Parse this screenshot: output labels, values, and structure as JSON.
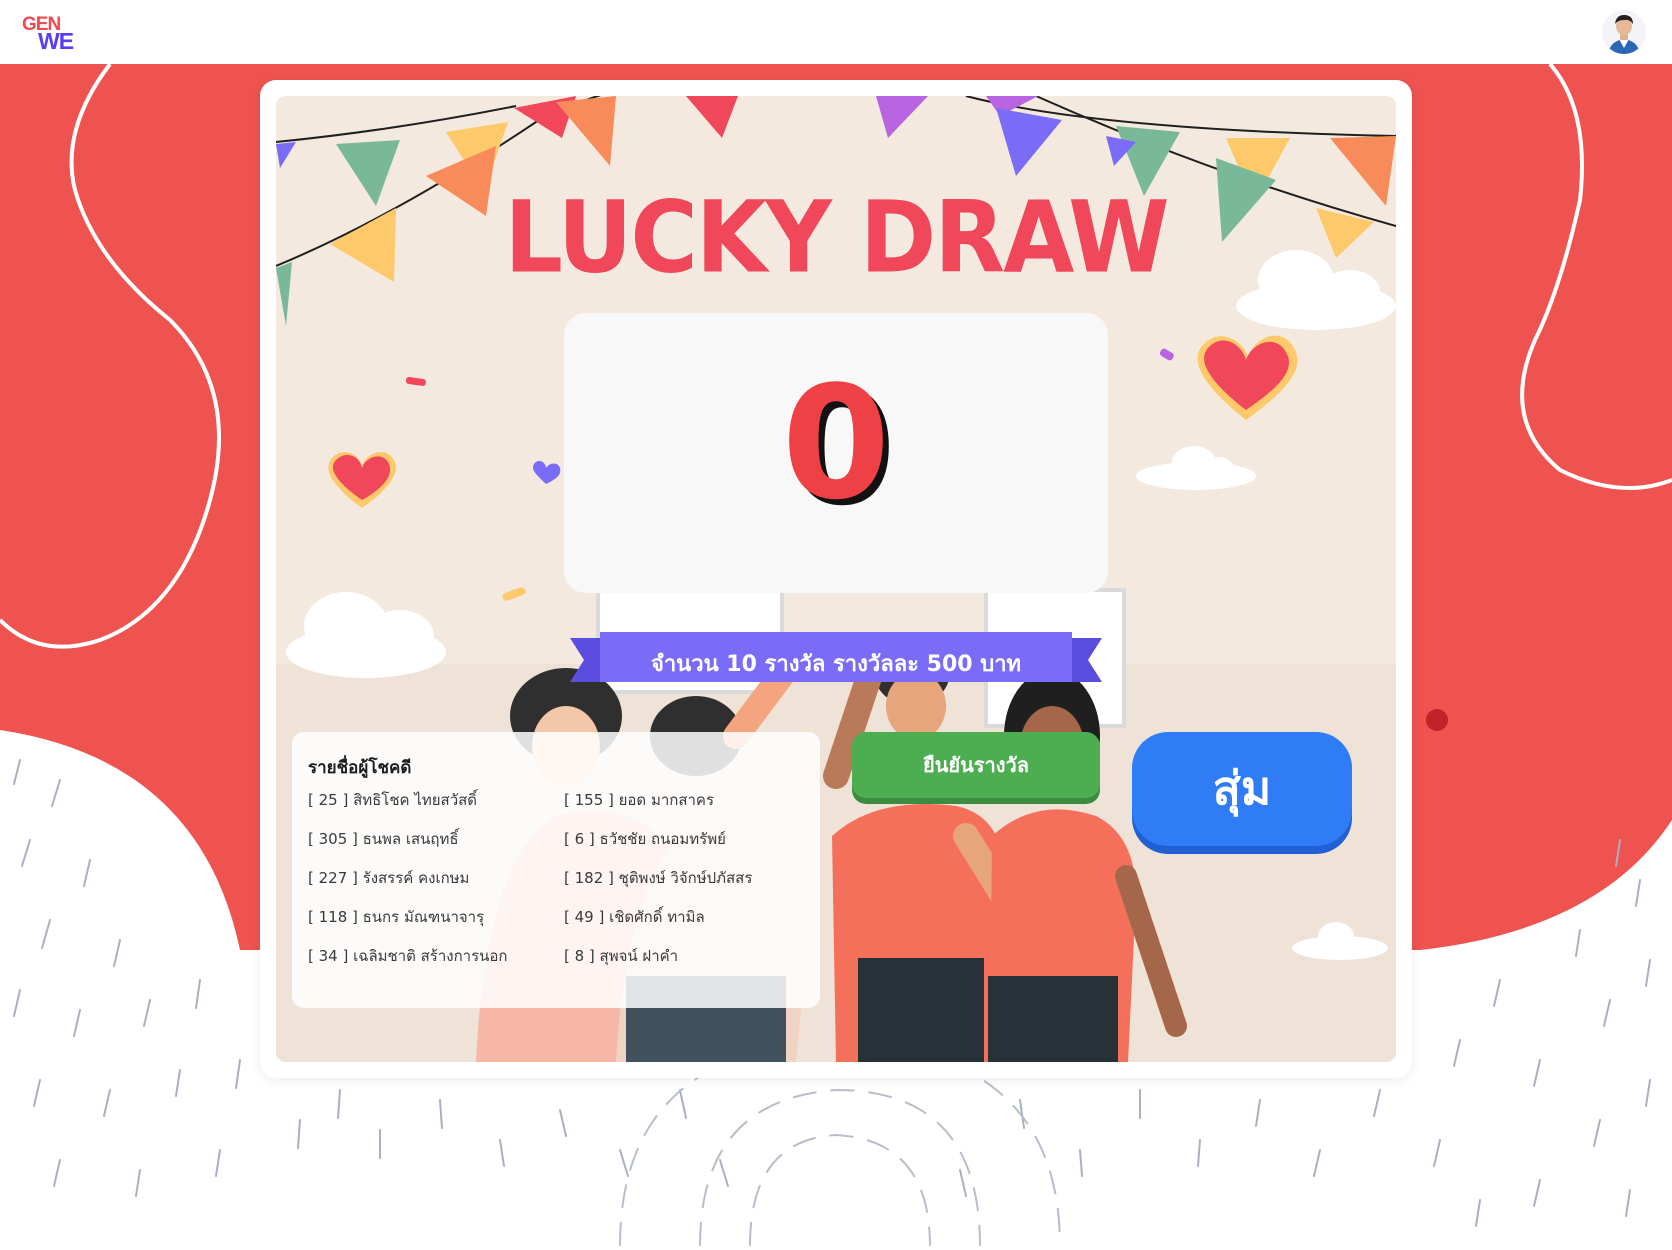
{
  "header": {
    "logo_line1": "GEN",
    "logo_line2": "WE"
  },
  "draw": {
    "title": "LUCKY DRAW",
    "current_number": "0",
    "prize_info": "จำนวน 10 รางวัล รางวัลละ 500 บาท"
  },
  "winners": {
    "heading": "รายชื่อผู้โชคดี",
    "column1": [
      "[ 25 ] สิทธิโชค ไทยสวัสดิ์",
      "[ 305 ] ธนพล เสนฤทธิ์",
      "[ 227 ] รังสรรค์ คงเกษม",
      "[ 118 ] ธนกร มัณฑนาจารุ",
      "[ 34 ] เฉลิมชาติ สร้างการนอก"
    ],
    "column2": [
      "[ 155 ] ยอด มากสาคร",
      "[ 6 ] ธวัชชัย ถนอมทรัพย์",
      "[ 182 ] ชุติพงษ์ วิจักษ์ปภัสสร",
      "[ 49 ] เชิดศักดิ์ ทามิล",
      "[ 8 ] สุพจน์ ฝาคำ"
    ]
  },
  "buttons": {
    "confirm_label": "ยืนยันรางวัล",
    "random_label": "สุ่ม"
  },
  "colors": {
    "background_red": "#ef5350",
    "title_red": "#f0485a",
    "ribbon_purple": "#7a6cf6",
    "confirm_green": "#4cae50",
    "random_blue": "#2f7cf6"
  },
  "icons": [
    "profile-avatar-icon",
    "heart-icon",
    "bunting-flags",
    "cloud"
  ]
}
